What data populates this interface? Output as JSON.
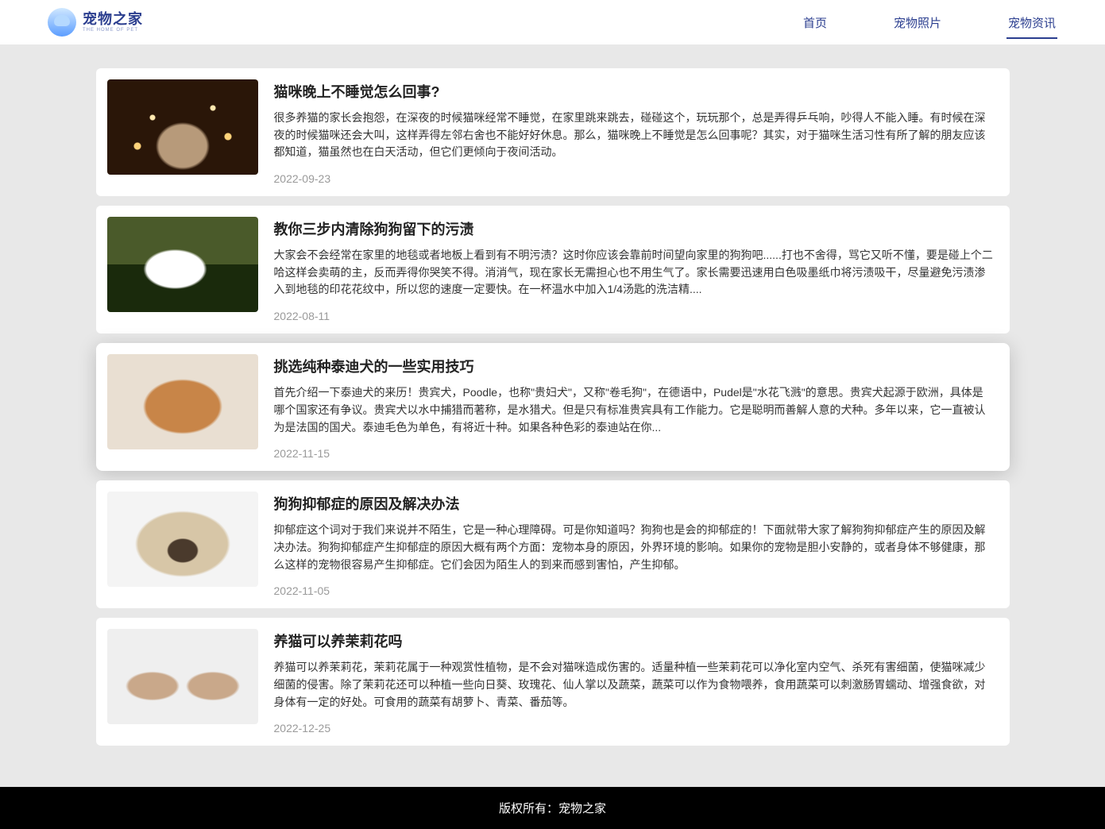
{
  "brand": {
    "name": "宠物之家",
    "sub": "THE HOME OF PET"
  },
  "nav": {
    "items": [
      {
        "label": "首页",
        "active": false
      },
      {
        "label": "宠物照片",
        "active": false
      },
      {
        "label": "宠物资讯",
        "active": true
      }
    ]
  },
  "articles": [
    {
      "title": "猫咪晚上不睡觉怎么回事?",
      "desc": "很多养猫的家长会抱怨，在深夜的时候猫咪经常不睡觉，在家里跳来跳去，碰碰这个，玩玩那个，总是弄得乒乓响，吵得人不能入睡。有时候在深夜的时候猫咪还会大叫，这样弄得左邻右舍也不能好好休息。那么，猫咪晚上不睡觉是怎么回事呢？其实，对于猫咪生活习性有所了解的朋友应该都知道，猫虽然也在白天活动，但它们更倾向于夜间活动。",
      "date": "2022-09-23",
      "thumb": "thumb1",
      "hovered": false
    },
    {
      "title": "教你三步内清除狗狗留下的污渍",
      "desc": "大家会不会经常在家里的地毯或者地板上看到有不明污渍？这时你应该会靠前时间望向家里的狗狗吧......打也不舍得，骂它又听不懂，要是碰上个二哈这样会卖萌的主，反而弄得你哭笑不得。消消气，现在家长无需担心也不用生气了。家长需要迅速用白色吸墨纸巾将污渍吸干，尽量避免污渍渗入到地毯的印花花纹中，所以您的速度一定要快。在一杯温水中加入1/4汤匙的洗洁精....",
      "date": "2022-08-11",
      "thumb": "thumb2",
      "hovered": false
    },
    {
      "title": "挑选纯种泰迪犬的一些实用技巧",
      "desc": "首先介绍一下泰迪犬的来历！贵宾犬，Poodle，也称\"贵妇犬\"，又称\"卷毛狗\"，在德语中，Pudel是\"水花飞溅\"的意思。贵宾犬起源于欧洲，具体是哪个国家还有争议。贵宾犬以水中捕猎而著称，是水猎犬。但是只有标准贵宾具有工作能力。它是聪明而善解人意的犬种。多年以来，它一直被认为是法国的国犬。泰迪毛色为单色，有将近十种。如果各种色彩的泰迪站在你...",
      "date": "2022-11-15",
      "thumb": "thumb3",
      "hovered": true
    },
    {
      "title": "狗狗抑郁症的原因及解决办法",
      "desc": "抑郁症这个词对于我们来说并不陌生，它是一种心理障碍。可是你知道吗？狗狗也是会的抑郁症的！下面就带大家了解狗狗抑郁症产生的原因及解决办法。狗狗抑郁症产生抑郁症的原因大概有两个方面：宠物本身的原因，外界环境的影响。如果你的宠物是胆小安静的，或者身体不够健康，那么这样的宠物很容易产生抑郁症。它们会因为陌生人的到来而感到害怕，产生抑郁。",
      "date": "2022-11-05",
      "thumb": "thumb4",
      "hovered": false
    },
    {
      "title": "养猫可以养茉莉花吗",
      "desc": "养猫可以养茉莉花，茉莉花属于一种观赏性植物，是不会对猫咪造成伤害的。适量种植一些茉莉花可以净化室内空气、杀死有害细菌，使猫咪减少细菌的侵害。除了茉莉花还可以种植一些向日葵、玫瑰花、仙人掌以及蔬菜，蔬菜可以作为食物喂养，食用蔬菜可以刺激肠胃蠕动、增强食欲，对身体有一定的好处。可食用的蔬菜有胡萝卜、青菜、番茄等。",
      "date": "2022-12-25",
      "thumb": "thumb5",
      "hovered": false
    }
  ],
  "footer": {
    "text": "版权所有：宠物之家"
  }
}
